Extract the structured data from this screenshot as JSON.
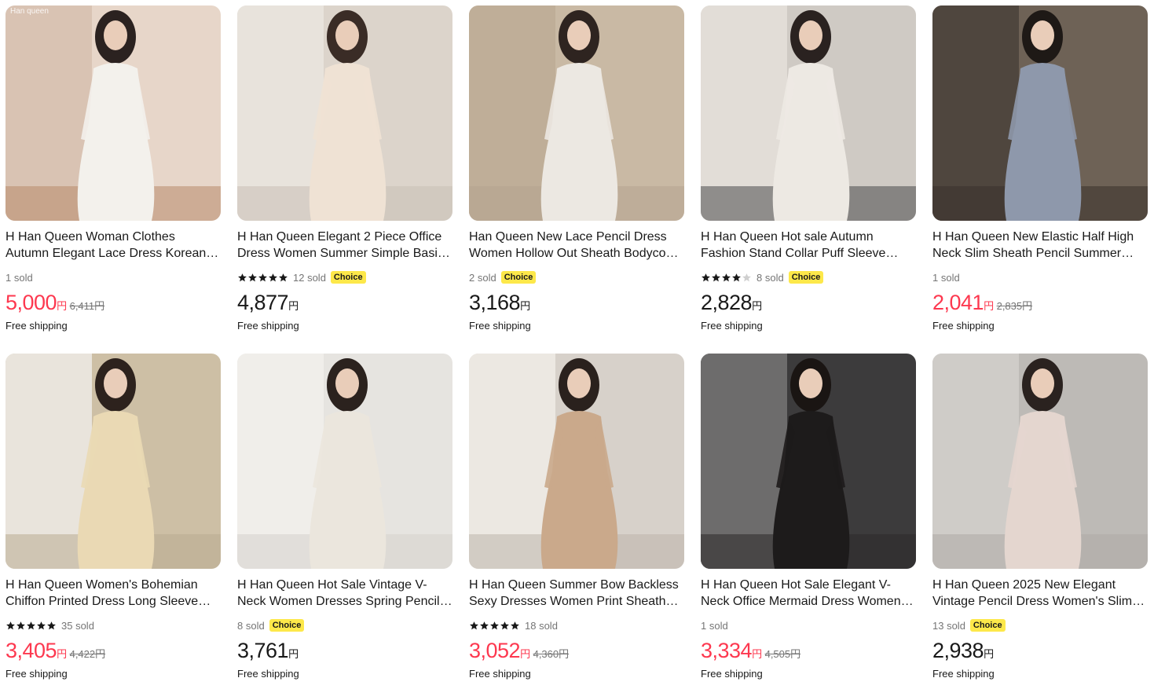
{
  "currency": "円",
  "watermark": "Han queen",
  "shipping_label": "Free shipping",
  "choice_label": "Choice",
  "products": [
    {
      "title": "H Han Queen Woman Clothes Autumn Elegant Lace Dress Korean Fashion",
      "sold": "1 sold",
      "stars": 0,
      "choice": false,
      "price": "5,000",
      "original_price": "6,411円",
      "sale": true,
      "photo": {
        "bg": "#e7d6c9",
        "wall": "#d9c3b3",
        "dress": "#f3f1ec",
        "hair": "#2b2220",
        "floor": "#b88a6a"
      }
    },
    {
      "title": "H Han Queen Elegant 2 Piece Office Dress Women Summer Simple Basic Set",
      "sold": "12 sold",
      "stars": 5,
      "choice": true,
      "price": "4,877",
      "original_price": "",
      "sale": false,
      "photo": {
        "bg": "#dcd4cb",
        "wall": "#e8e3dc",
        "dress": "#efe2d4",
        "hair": "#3a2c26",
        "floor": "#c9c0b6"
      }
    },
    {
      "title": "Han Queen New Lace Pencil Dress Women Hollow Out Sheath Bodycon Dress",
      "sold": "2 sold",
      "stars": 0,
      "choice": true,
      "price": "3,168",
      "original_price": "",
      "sale": false,
      "photo": {
        "bg": "#c9b9a4",
        "wall": "#bfae98",
        "dress": "#ece8e2",
        "hair": "#2e2420",
        "floor": "#b5a48f"
      }
    },
    {
      "title": "H Han Queen Hot sale Autumn Fashion Stand Collar Puff Sleeve Dress",
      "sold": "8 sold",
      "stars": 4,
      "choice": true,
      "price": "2,828",
      "original_price": "",
      "sale": false,
      "photo": {
        "bg": "#cfcac4",
        "wall": "#e2ddd7",
        "dress": "#ede9e3",
        "hair": "#2a2220",
        "floor": "#4b4a4c"
      }
    },
    {
      "title": "H Han Queen New Elastic Half High Neck Slim Sheath Pencil Summer Dress",
      "sold": "1 sold",
      "stars": 0,
      "choice": false,
      "price": "2,041",
      "original_price": "2,835円",
      "sale": true,
      "photo": {
        "bg": "#6e6256",
        "wall": "#4f463e",
        "dress": "#8e98ab",
        "hair": "#1e1916",
        "floor": "#3a322c"
      }
    },
    {
      "title": "H Han Queen Women's Bohemian Chiffon Printed Dress Long Sleeve Maxi",
      "sold": "35 sold",
      "stars": 5,
      "choice": false,
      "price": "3,405",
      "original_price": "4,422円",
      "sale": true,
      "photo": {
        "bg": "#cdbfa5",
        "wall": "#e9e4dc",
        "dress": "#ead9b4",
        "hair": "#2d221d",
        "floor": "#b9ab92"
      }
    },
    {
      "title": "H Han Queen Hot Sale Vintage V-Neck Women Dresses Spring Pencil Dress",
      "sold": "8 sold",
      "stars": 0,
      "choice": true,
      "price": "3,761",
      "original_price": "",
      "sale": false,
      "photo": {
        "bg": "#e6e4e0",
        "wall": "#f0eeea",
        "dress": "#ebe6dd",
        "hair": "#2b221e",
        "floor": "#d6d2cc"
      }
    },
    {
      "title": "H Han Queen Summer Bow Backless Sexy Dresses Women Print Sheath Dress",
      "sold": "18 sold",
      "stars": 5,
      "choice": false,
      "price": "3,052",
      "original_price": "4,360円",
      "sale": true,
      "photo": {
        "bg": "#d7d1ca",
        "wall": "#ece8e2",
        "dress": "#caa98b",
        "hair": "#2a211d",
        "floor": "#bdb5ab"
      }
    },
    {
      "title": "H Han Queen Hot Sale Elegant V-Neck Office Mermaid Dress Women Lace",
      "sold": "1 sold",
      "stars": 0,
      "choice": false,
      "price": "3,334",
      "original_price": "4,505円",
      "sale": true,
      "photo": {
        "bg": "#3c3b3c",
        "wall": "#6d6c6c",
        "dress": "#1d1b1b",
        "hair": "#1a1513",
        "floor": "#2c2a2a"
      }
    },
    {
      "title": "H Han Queen 2025 New Elegant Vintage Pencil Dress Women's Slim Fit",
      "sold": "13 sold",
      "stars": 0,
      "choice": true,
      "price": "2,938",
      "original_price": "",
      "sale": false,
      "photo": {
        "bg": "#bdbab6",
        "wall": "#cfccc8",
        "dress": "#e4d6cf",
        "hair": "#2a221f",
        "floor": "#aeaaa5"
      }
    }
  ]
}
